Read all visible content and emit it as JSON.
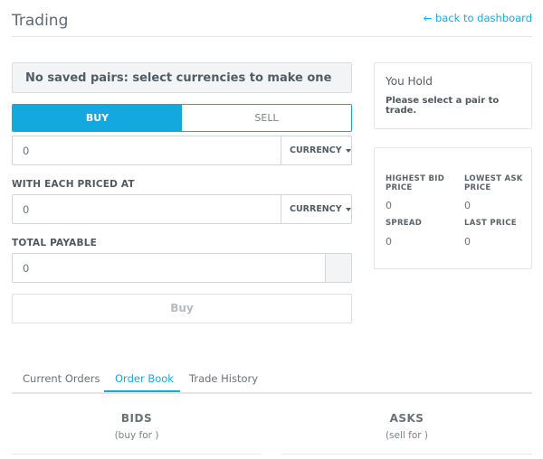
{
  "header": {
    "title": "Trading",
    "back_link": "← back to dashboard"
  },
  "pair_banner": "No saved pairs: select currencies to make one",
  "trade_toggle": {
    "buy": "BUY",
    "sell": "SELL",
    "selected": "BUY"
  },
  "amount_field": {
    "value": "0",
    "currency": "CURRENCY"
  },
  "price_field": {
    "label": "WITH EACH PRICED AT",
    "value": "0",
    "currency": "CURRENCY"
  },
  "total_field": {
    "label": "TOTAL PAYABLE",
    "value": "0"
  },
  "submit_button": "Buy",
  "hold_panel": {
    "title": "You Hold",
    "message": "Please select a pair to trade."
  },
  "stats": {
    "highest_bid_label": "HIGHEST BID PRICE",
    "highest_bid_value": "0",
    "lowest_ask_label": "LOWEST ASK PRICE",
    "lowest_ask_value": "0",
    "spread_label": "SPREAD",
    "spread_value": "0",
    "last_price_label": "LAST PRICE",
    "last_price_value": "0"
  },
  "tabs": {
    "items": [
      "Current Orders",
      "Order Book",
      "Trade History"
    ],
    "active": "Order Book"
  },
  "order_book": {
    "bids_title": "BIDS",
    "bids_sub": "(buy for )",
    "asks_title": "ASKS",
    "asks_sub": "(sell for )"
  },
  "colors": {
    "accent": "#13a9de",
    "text": "#525c64",
    "border": "#d3d6d9"
  }
}
